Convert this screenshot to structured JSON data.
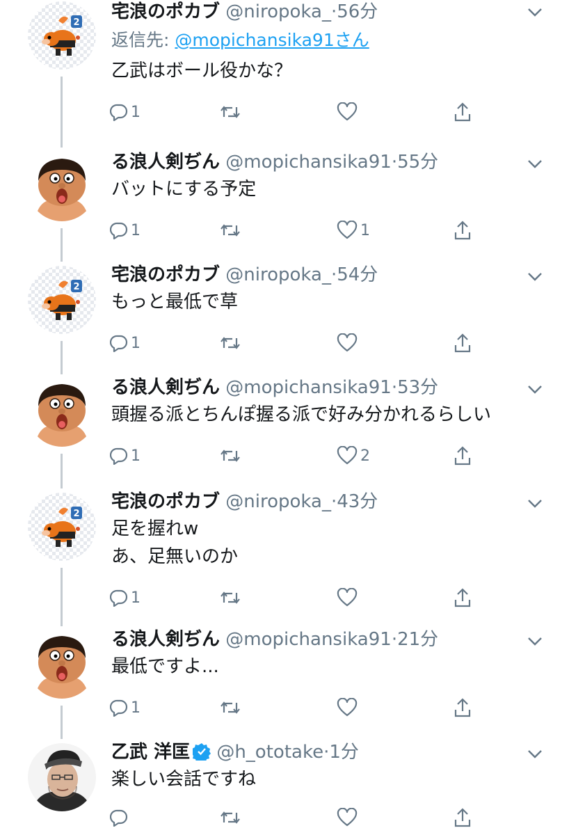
{
  "colors": {
    "text": "#14171a",
    "secondary": "#657786",
    "link": "#1da1f2",
    "thread_line": "#c4cbd1",
    "verified": "#1da1f2"
  },
  "tweets": [
    {
      "name": "宅浪のポカブ",
      "handle": "@niropoka_",
      "sep": "·",
      "time": "56分",
      "reply_label": "返信先: ",
      "reply_mention": "@mopichansika91さん",
      "lines": [
        "乙武はボール役かな？"
      ],
      "replies": "1",
      "retweets": "",
      "likes": "",
      "avatar": "tepig-avatar"
    },
    {
      "name": "る浪人剣ぢん",
      "handle": "@mopichansika91",
      "sep": "·",
      "time": "55分",
      "lines": [
        "バットにする予定"
      ],
      "replies": "1",
      "retweets": "",
      "likes": "1",
      "avatar": "cartoon-face-avatar"
    },
    {
      "name": "宅浪のポカブ",
      "handle": "@niropoka_",
      "sep": "·",
      "time": "54分",
      "lines": [
        "もっと最低で草"
      ],
      "replies": "1",
      "retweets": "",
      "likes": "",
      "avatar": "tepig-avatar"
    },
    {
      "name": "る浪人剣ぢん",
      "handle": "@mopichansika91",
      "sep": "·",
      "time": "53分",
      "lines": [
        "頭握る派とちんぽ握る派で好み分かれるらしい"
      ],
      "replies": "1",
      "retweets": "",
      "likes": "2",
      "avatar": "cartoon-face-avatar"
    },
    {
      "name": "宅浪のポカブ",
      "handle": "@niropoka_",
      "sep": "·",
      "time": "43分",
      "lines": [
        "足を握れw",
        "あ、足無いのか"
      ],
      "replies": "1",
      "retweets": "",
      "likes": "",
      "avatar": "tepig-avatar"
    },
    {
      "name": "る浪人剣ぢん",
      "handle": "@mopichansika91",
      "sep": "·",
      "time": "21分",
      "lines": [
        "最低ですよ..."
      ],
      "replies": "1",
      "retweets": "",
      "likes": "",
      "avatar": "cartoon-face-avatar"
    },
    {
      "name": "乙武 洋匡",
      "handle": "@h_ototake",
      "sep": "·",
      "time": "1分",
      "verified": true,
      "lines": [
        "楽しい会話ですね"
      ],
      "replies": "",
      "retweets": "",
      "likes": "",
      "avatar": "photo-avatar"
    }
  ]
}
